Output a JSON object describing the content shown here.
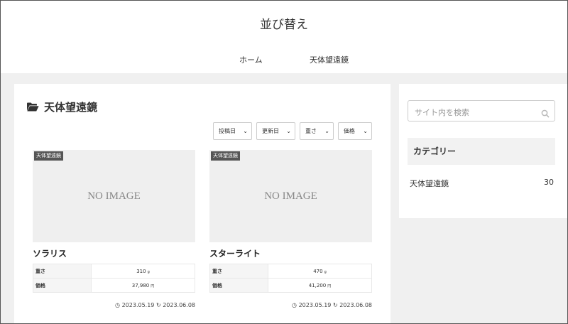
{
  "header": {
    "site_title": "並び替え",
    "nav": [
      "ホーム",
      "天体望遠鏡"
    ]
  },
  "main": {
    "archive_title": "天体望遠鏡",
    "sort_options": [
      "投稿日",
      "更新日",
      "重さ",
      "価格"
    ],
    "products": [
      {
        "category": "天体望遠鏡",
        "no_image": "NO IMAGE",
        "title": "ソラリス",
        "weight_label": "重さ",
        "weight": "310",
        "weight_unit": "g",
        "price_label": "価格",
        "price": "37,980",
        "price_unit": "円",
        "posted": "2023.05.19",
        "updated": "2023.06.08"
      },
      {
        "category": "天体望遠鏡",
        "no_image": "NO IMAGE",
        "title": "スターライト",
        "weight_label": "重さ",
        "weight": "470",
        "weight_unit": "g",
        "price_label": "価格",
        "price": "41,200",
        "price_unit": "円",
        "posted": "2023.05.19",
        "updated": "2023.06.08"
      }
    ]
  },
  "sidebar": {
    "search_placeholder": "サイト内を検索",
    "categories_heading": "カテゴリー",
    "categories": [
      {
        "name": "天体望遠鏡",
        "count": "30"
      }
    ]
  },
  "icons": {
    "archive": "folder-open-icon",
    "search": "search-icon",
    "posted": "clock-icon",
    "updated": "refresh-icon"
  }
}
